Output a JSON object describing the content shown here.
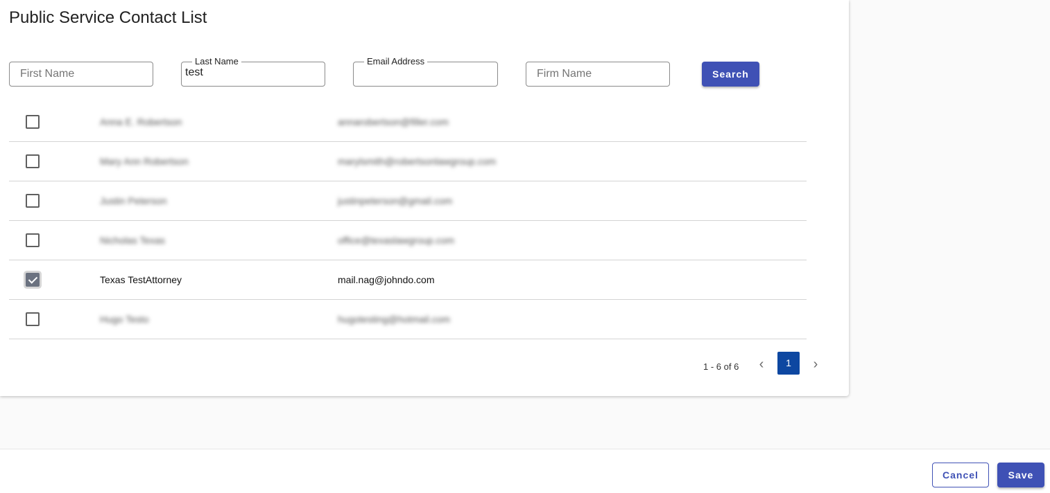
{
  "page": {
    "title": "Public Service Contact List"
  },
  "search": {
    "first_name": {
      "placeholder": "First Name",
      "value": ""
    },
    "last_name": {
      "label": "Last Name",
      "value": "test"
    },
    "email": {
      "label": "Email Address",
      "value": ""
    },
    "firm_name": {
      "placeholder": "Firm Name",
      "value": ""
    },
    "button_label": "Search"
  },
  "contacts": [
    {
      "name": "Anna E. Robertson",
      "email": "annarobertson@filler.com",
      "checked": false,
      "redacted": true
    },
    {
      "name": "Mary Ann Robertson",
      "email": "marylsmith@robertsonlawgroup.com",
      "checked": false,
      "redacted": true
    },
    {
      "name": "Justin Peterson",
      "email": "justinpeterson@gmail.com",
      "checked": false,
      "redacted": true
    },
    {
      "name": "Nicholas Texas",
      "email": "office@texaslawgroup.com",
      "checked": false,
      "redacted": true
    },
    {
      "name": "Texas TestAttorney",
      "email": "mail.nag@johndo.com",
      "checked": true,
      "redacted": false
    },
    {
      "name": "Hugo Testo",
      "email": "hugotesting@hotmail.com",
      "checked": false,
      "redacted": true
    }
  ],
  "pagination": {
    "summary": "1 - 6 of 6",
    "current_page": "1",
    "prev_icon": "chevron-left-icon",
    "next_icon": "chevron-right-icon"
  },
  "footer": {
    "cancel_label": "Cancel",
    "save_label": "Save"
  },
  "colors": {
    "primary": "#3f51b5",
    "page_active": "#0d47a1",
    "checkbox_checked": "#6b7280"
  }
}
